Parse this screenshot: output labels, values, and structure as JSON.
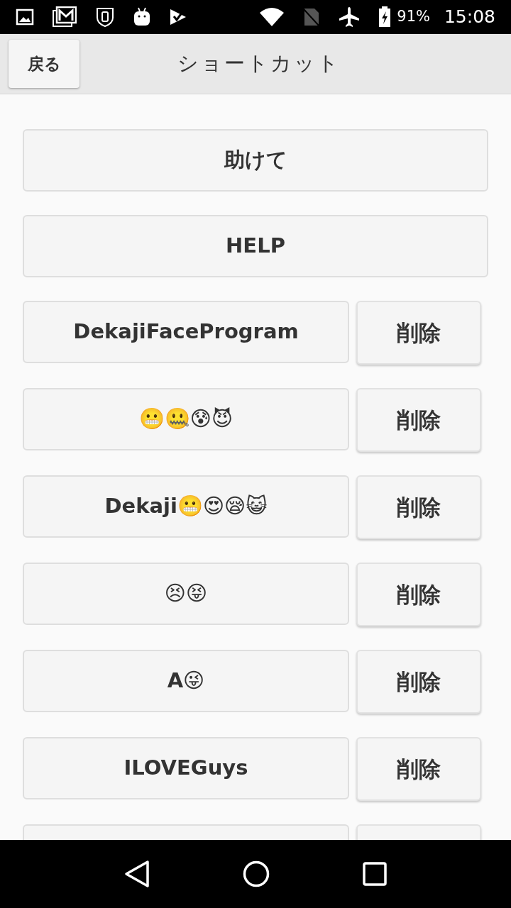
{
  "status_bar": {
    "battery": "91%",
    "time": "15:08"
  },
  "header": {
    "back_button": "戻る",
    "title": "ショートカット"
  },
  "shortcuts": [
    {
      "kind": "fixed",
      "label": "助けて"
    },
    {
      "kind": "fixed",
      "label": "HELP"
    },
    {
      "kind": "custom",
      "label": "DekajiFaceProgram",
      "delete": "削除"
    },
    {
      "kind": "custom",
      "label": "😬🤐😰😈",
      "delete": "削除"
    },
    {
      "kind": "custom",
      "label": "Dekaji😬😍😪😺",
      "delete": "削除"
    },
    {
      "kind": "custom",
      "label": "😣😝",
      "delete": "削除"
    },
    {
      "kind": "custom",
      "label": "A😜",
      "delete": "削除"
    },
    {
      "kind": "custom",
      "label": "ILOVEGuys",
      "delete": "削除"
    },
    {
      "kind": "cut"
    }
  ]
}
